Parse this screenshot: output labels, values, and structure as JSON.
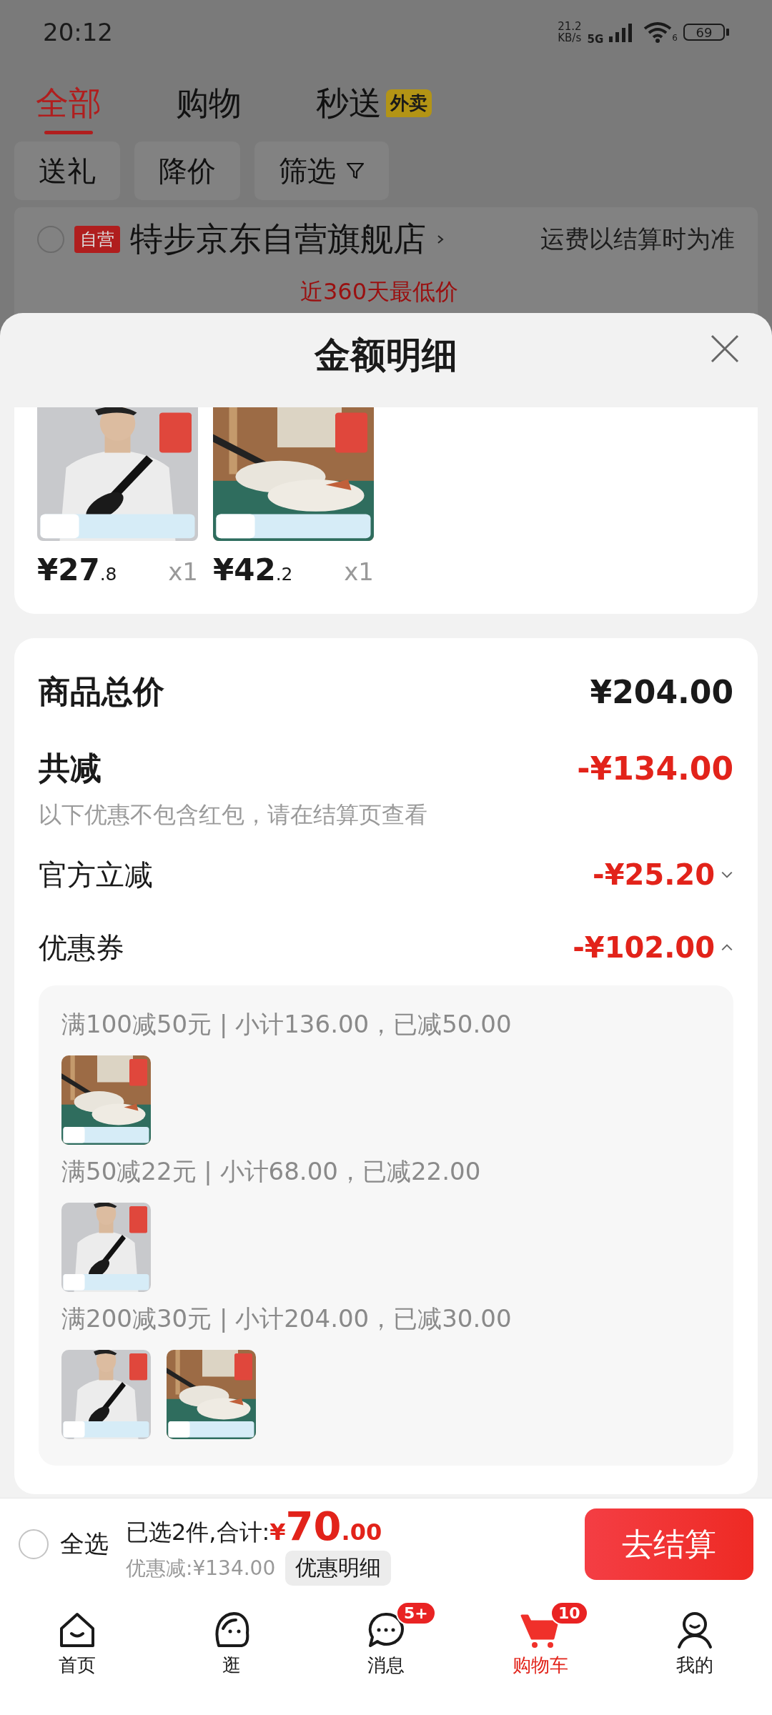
{
  "status_bar": {
    "time": "20:12",
    "speed": "21.2",
    "speed_unit": "KB/s",
    "network": "5G",
    "wifi_badge": "6",
    "battery": "69"
  },
  "tabs": [
    {
      "label": "全部",
      "selected": true
    },
    {
      "label": "购物",
      "selected": false
    },
    {
      "label": "秒送",
      "selected": false,
      "badge": "外卖"
    }
  ],
  "filters": [
    {
      "label": "送礼",
      "kind": "plain"
    },
    {
      "label": "降价",
      "kind": "plain"
    },
    {
      "label": "筛选",
      "kind": "filter"
    }
  ],
  "store": {
    "checked": false,
    "badge": "自营",
    "name": "特步京东自营旗舰店",
    "shipping_note": "运费以结算时为准",
    "price_note": "近360天最低价"
  },
  "sheet": {
    "title": "金额明细",
    "products": [
      {
        "kind": "picture",
        "price": "¥27.8",
        "quantity": "x1"
      },
      {
        "kind": "picture",
        "price": "¥42.2",
        "quantity": "x1"
      }
    ],
    "summary": [
      {
        "kind": "total",
        "label": "商品总价",
        "value": "¥204.00"
      },
      {
        "kind": "discount",
        "label": "共减",
        "value": "-¥134.00",
        "note": "以下优惠不包含红包，请在结算页查看"
      },
      {
        "kind": "item",
        "label": "官方立减",
        "value": "-¥25.20",
        "expanded": false
      },
      {
        "kind": "item",
        "label": "优惠券",
        "value": "-¥102.00",
        "expanded": true
      }
    ],
    "coupons": [
      {
        "text": "满100减50元 | 小计136.00，已减50.00"
      },
      {
        "text": "满50减22元 | 小计68.00，已减22.00"
      },
      {
        "text": "满200减30元 | 小计204.00，已减30.00"
      }
    ]
  },
  "checkout_bar": {
    "select_all": {
      "label": "全选",
      "checked": false
    },
    "selected_text": "已选2件,合计:",
    "total": "¥70.00",
    "discount_text": "优惠减:¥134.00",
    "detail_button": "优惠明细",
    "checkout_button": "去结算"
  },
  "nav": [
    {
      "kind": "home",
      "label": "首页",
      "selected": false
    },
    {
      "kind": "explore",
      "label": "逛",
      "selected": false
    },
    {
      "kind": "message",
      "label": "消息",
      "selected": false,
      "badge": "5+"
    },
    {
      "kind": "cart",
      "label": "购物车",
      "selected": true,
      "badge": "10"
    },
    {
      "kind": "profile",
      "label": "我的",
      "selected": false
    }
  ]
}
